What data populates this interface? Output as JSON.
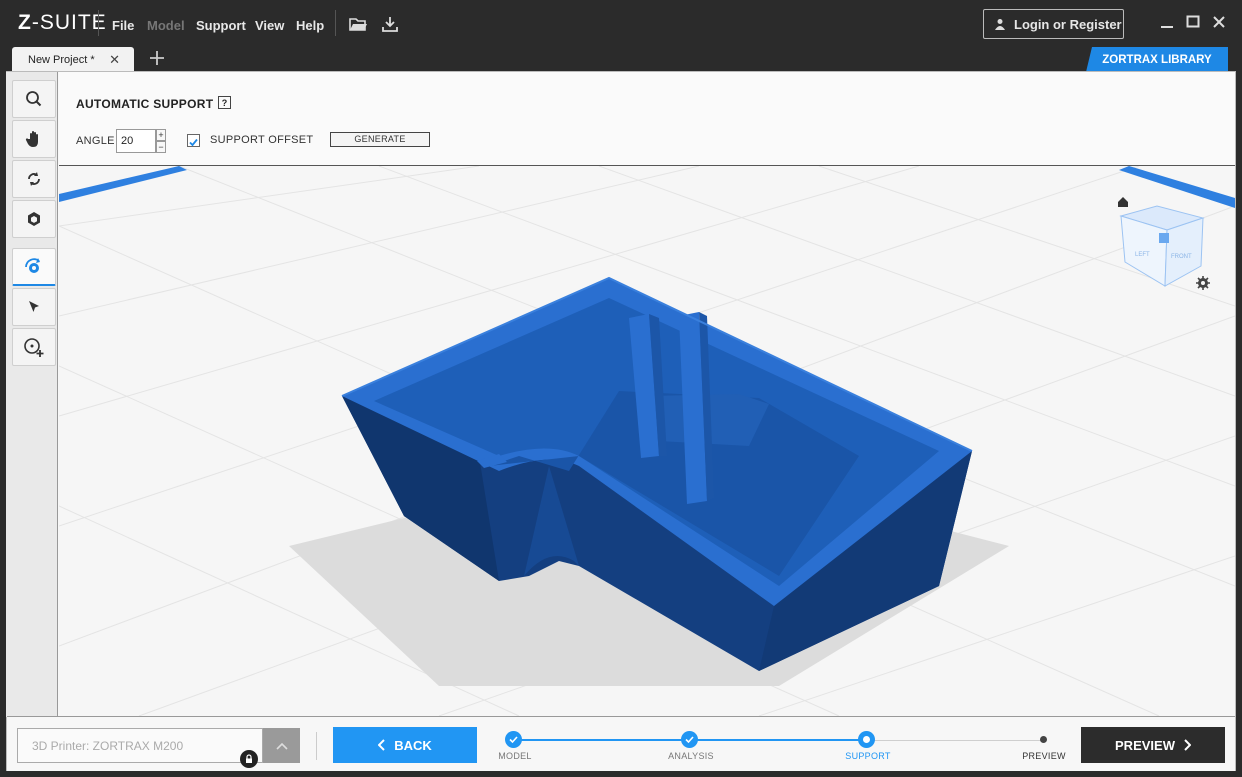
{
  "app": {
    "logo_prefix": "Z",
    "logo_suffix": "-SUITE",
    "menu": [
      "File",
      "Model",
      "Support",
      "View",
      "Help"
    ],
    "login_label": "Login or Register"
  },
  "tabs": {
    "project_tab": "New Project *",
    "close_glyph": "✕",
    "library_label": "ZORTRAX LIBRARY"
  },
  "toolbar": {
    "tools": [
      "zoom-tool",
      "pan-tool",
      "rotate-tool",
      "view-tool",
      "support-tool",
      "select-tool",
      "add-tool"
    ],
    "active_tool": "support-tool"
  },
  "panel": {
    "title": "AUTOMATIC SUPPORT",
    "help_glyph": "?",
    "angle_label": "ANGLE",
    "angle_value": "20",
    "spin_up": "+",
    "spin_down": "−",
    "offset_label": "SUPPORT OFFSET",
    "offset_checked": true,
    "generate_label": "GENERATE"
  },
  "viewcube": {
    "left_label": "LEFT",
    "front_label": "FRONT"
  },
  "bottom": {
    "printer_placeholder": "3D Printer: ZORTRAX M200",
    "back_label": "BACK",
    "preview_label": "PREVIEW",
    "steps": [
      {
        "label": "MODEL",
        "state": "done"
      },
      {
        "label": "ANALYSIS",
        "state": "done"
      },
      {
        "label": "SUPPORT",
        "state": "current"
      },
      {
        "label": "PREVIEW",
        "state": "pending"
      }
    ]
  },
  "colors": {
    "accent": "#2196f3",
    "model_top": "#1e5fb8",
    "model_side": "#174a94",
    "titlebar": "#2b2b2b"
  }
}
